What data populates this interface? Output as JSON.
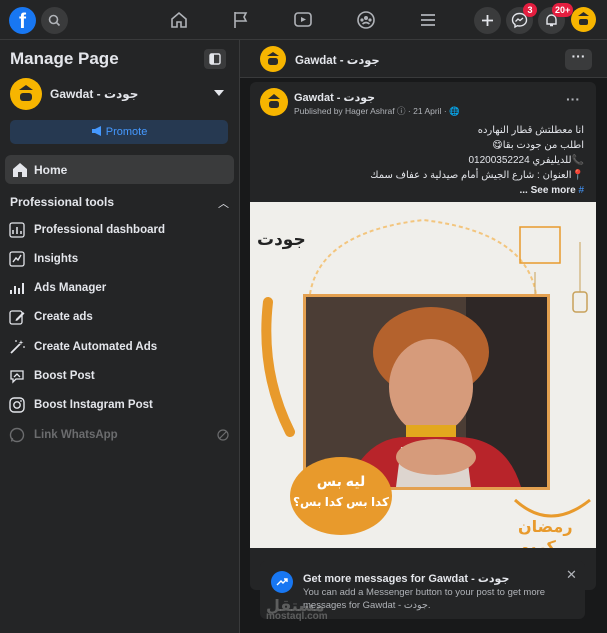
{
  "topbar": {
    "logo_letter": "f",
    "badges": {
      "messenger": "3",
      "notifications": "20+"
    }
  },
  "sidebar": {
    "title": "Manage Page",
    "page_name": "Gawdat - جودت",
    "promote_label": "Promote",
    "home_label": "Home",
    "section_title": "Professional tools",
    "tools": [
      {
        "label": "Professional dashboard",
        "icon": "dashboard-icon"
      },
      {
        "label": "Insights",
        "icon": "insights-icon"
      },
      {
        "label": "Ads Manager",
        "icon": "ads-manager-icon"
      },
      {
        "label": "Create ads",
        "icon": "edit-icon"
      },
      {
        "label": "Create Automated Ads",
        "icon": "magic-wand-icon"
      },
      {
        "label": "Boost Post",
        "icon": "boost-icon"
      },
      {
        "label": "Boost Instagram Post",
        "icon": "instagram-icon"
      },
      {
        "label": "Link WhatsApp",
        "icon": "whatsapp-icon",
        "disabled": true
      }
    ]
  },
  "header": {
    "page_name": "Gawdat - جودت",
    "more": "···"
  },
  "post": {
    "page_name": "Gawdat - جودت",
    "published_by": "Published by Hager Ashraf",
    "date": "21 April",
    "lines": [
      "انا معطلتش قطار النهارده",
      "اطلب من جودت بقا😋",
      "📞للديليفري 01200352224",
      "📍العنوان : شارع الجيش أمام صيدلية  د عفاف سمك"
    ],
    "see_more": "See more ...",
    "hashtag": "#",
    "image": {
      "brand_text": "جودت",
      "speech_lines": [
        "ليه بس",
        "كدا بس كدا بس؟"
      ],
      "ramadan_text": "رمضان كريم"
    }
  },
  "cta": {
    "title": "Get more messages for Gawdat - جودت",
    "desc": "You can add a Messenger button to your post to get more messages for Gawdat - جودت."
  },
  "watermark": {
    "main": "مستقل",
    "sub": "mostaql.com"
  },
  "colors": {
    "accent": "#1877f2",
    "brand_yellow": "#f7b500",
    "image_orange": "#e89a2c",
    "badge_red": "#e41e3f"
  }
}
